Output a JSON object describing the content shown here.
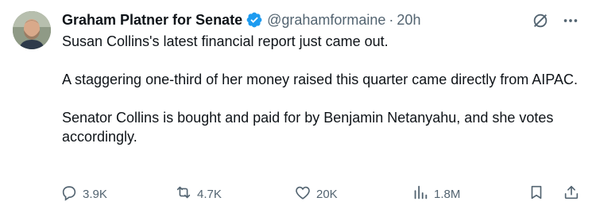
{
  "author": {
    "display_name": "Graham Platner for Senate",
    "handle": "@grahamformaine",
    "separator": "·",
    "time": "20h",
    "verified": true,
    "verified_color": "#1d9bf0"
  },
  "tweet": {
    "paragraphs": [
      "Susan Collins's latest financial report just came out.",
      "A staggering one-third of her money raised this quarter came directly from AIPAC.",
      "Senator Collins is bought and paid for by Benjamin Netanyahu, and she votes accordingly."
    ]
  },
  "actions": {
    "replies": "3.9K",
    "reposts": "4.7K",
    "likes": "20K",
    "views": "1.8M"
  },
  "icons": {
    "top": [
      "grok-icon",
      "more-icon"
    ],
    "actions": [
      "reply-icon",
      "repost-icon",
      "like-icon",
      "views-icon",
      "bookmark-icon",
      "share-icon"
    ]
  },
  "colors": {
    "text_primary": "#0f1419",
    "text_secondary": "#536471",
    "accent": "#1d9bf0"
  }
}
